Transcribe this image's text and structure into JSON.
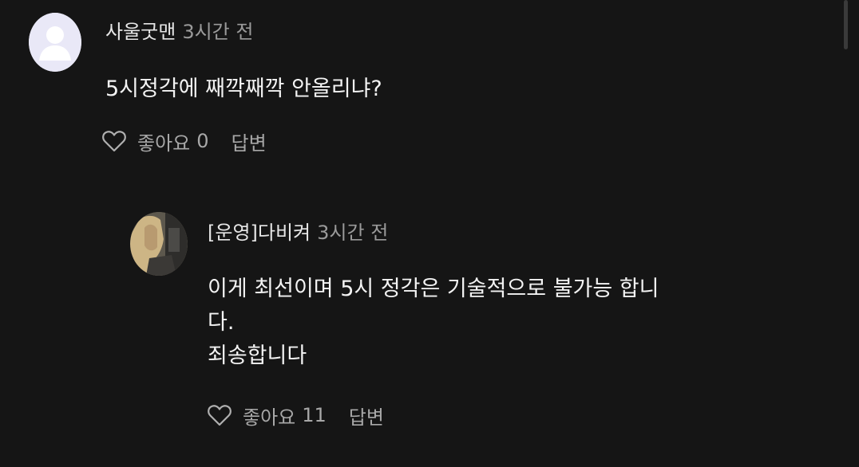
{
  "comments": [
    {
      "author": "사울굿맨",
      "time": "3시간 전",
      "lines": [
        "5시정각에 째깍째깍 안올리냐?"
      ],
      "like_label": "좋아요",
      "like_count": "0",
      "reply_label": "답변",
      "avatar_icon": "default-user-avatar-icon"
    }
  ],
  "replies": [
    {
      "author": "[운영]다비켜",
      "time": "3시간 전",
      "lines": [
        "이게 최선이며 5시 정각은 기술적으로 불가능 합니",
        "다.",
        "죄송합니다"
      ],
      "like_label": "좋아요",
      "like_count": "11",
      "reply_label": "답변",
      "avatar_icon": "user-photo-avatar"
    }
  ],
  "colors": {
    "background": "#151515",
    "text": "#f3f3f3",
    "muted": "#9a9a9a",
    "default_avatar": "#e9e8f7"
  }
}
